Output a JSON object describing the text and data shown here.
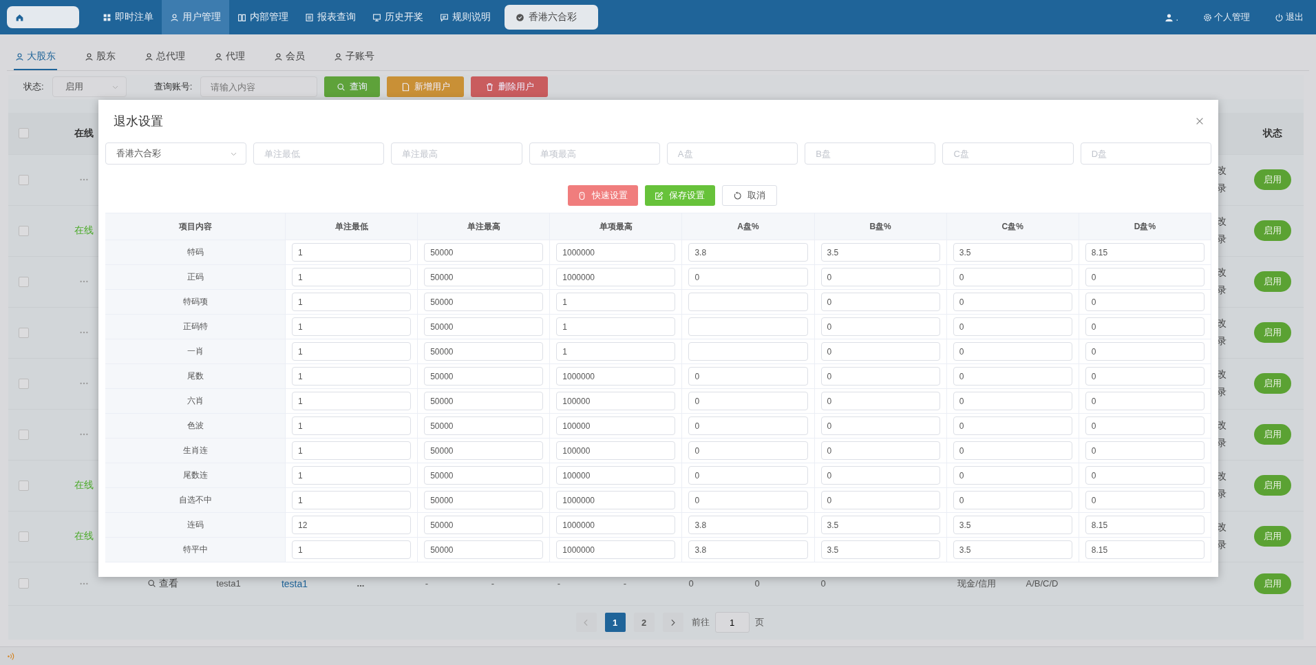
{
  "topbar": {
    "nav": [
      {
        "label": "即时注单",
        "selected": false
      },
      {
        "label": "用户管理",
        "selected": true
      },
      {
        "label": "内部管理",
        "selected": false
      },
      {
        "label": "报表查询",
        "selected": false
      },
      {
        "label": "历史开奖",
        "selected": false
      },
      {
        "label": "规则说明",
        "selected": false
      }
    ],
    "game_tab": {
      "label": "香港六合彩"
    },
    "user": {
      "name": "."
    },
    "links": [
      "个人管理",
      "退出"
    ]
  },
  "subtabs": [
    {
      "label": "大股东",
      "selected": true
    },
    {
      "label": "股东",
      "selected": false
    },
    {
      "label": "总代理",
      "selected": false
    },
    {
      "label": "代理",
      "selected": false
    },
    {
      "label": "会员",
      "selected": false
    },
    {
      "label": "子账号",
      "selected": false
    }
  ],
  "filters": {
    "status_label": "状态:",
    "status_value": "启用",
    "account_label": "查询账号:",
    "account_placeholder": "请输入内容",
    "buttons": [
      {
        "label": "查询",
        "kind": "search"
      },
      {
        "label": "新增用户",
        "kind": "add"
      },
      {
        "label": "删除用户",
        "kind": "delete"
      }
    ]
  },
  "table": {
    "header_checked": false,
    "header_online": "在线",
    "header_status": "状态",
    "rows": [
      {
        "checked": false,
        "online": false,
        "note": [
          "改",
          "录"
        ],
        "status": "启用"
      },
      {
        "checked": false,
        "online": true,
        "online_label": "在线",
        "note": [
          "改",
          "录"
        ],
        "status": "启用"
      },
      {
        "checked": false,
        "online": false,
        "note": [
          "改",
          "录"
        ],
        "status": "启用"
      },
      {
        "checked": false,
        "online": false,
        "note": [
          "改",
          "录"
        ],
        "status": "启用"
      },
      {
        "checked": false,
        "online": false,
        "note": [
          "改",
          "录"
        ],
        "status": "启用"
      },
      {
        "checked": false,
        "online": false,
        "note": [
          "改",
          "录"
        ],
        "status": "启用"
      },
      {
        "checked": false,
        "online": true,
        "online_label": "在线",
        "note": [
          "改",
          "录"
        ],
        "status": "启用"
      },
      {
        "checked": false,
        "online": true,
        "online_label": "在线",
        "note": [
          "改",
          "录"
        ],
        "status": "启用"
      }
    ],
    "last_row": {
      "checked": false,
      "online": false,
      "view": "查看",
      "account": "testa1",
      "name": "testa1",
      "column_6": "...",
      "cells": [
        "-",
        "-",
        "-",
        "-",
        "0",
        "0",
        "0"
      ],
      "mode": "现金/信用",
      "plates": "A/B/C/D",
      "status": "启用"
    }
  },
  "pagination": {
    "pages": [
      {
        "label": "1",
        "selected": true
      },
      {
        "label": "2",
        "selected": false
      }
    ],
    "goto_label": "前往",
    "goto_value": "1",
    "page_label": "页"
  },
  "modal": {
    "title": "退水设置",
    "game": "香港六合彩",
    "filters": [
      {
        "placeholder": "单注最低"
      },
      {
        "placeholder": "单注最高"
      },
      {
        "placeholder": "单项最高"
      },
      {
        "placeholder": "A盘"
      },
      {
        "placeholder": "B盘"
      },
      {
        "placeholder": "C盘"
      },
      {
        "placeholder": "D盘"
      }
    ],
    "buttons": [
      {
        "label": "快速设置",
        "kind": "quick"
      },
      {
        "label": "保存设置",
        "kind": "save"
      },
      {
        "label": "取消",
        "kind": "cancel"
      }
    ],
    "columns": [
      "项目内容",
      "单注最低",
      "单注最高",
      "单项最高",
      "A盘%",
      "B盘%",
      "C盘%",
      "D盘%"
    ],
    "rows": [
      {
        "item": "特码",
        "min": "1",
        "max": "50000",
        "item_max": "1000000",
        "a": "3.8",
        "b": "3.5",
        "c": "3.5",
        "d": "8.15"
      },
      {
        "item": "正码",
        "min": "1",
        "max": "50000",
        "item_max": "1000000",
        "a": "0",
        "b": "0",
        "c": "0",
        "d": "0"
      },
      {
        "item": "特码项",
        "min": "1",
        "max": "50000",
        "item_max": "1",
        "b": "0",
        "c": "0",
        "d": "0"
      },
      {
        "item": "正码特",
        "min": "1",
        "max": "50000",
        "item_max": "1",
        "b": "0",
        "c": "0",
        "d": "0"
      },
      {
        "item": "一肖",
        "min": "1",
        "max": "50000",
        "item_max": "1",
        "b": "0",
        "c": "0",
        "d": "0"
      },
      {
        "item": "尾数",
        "min": "1",
        "max": "50000",
        "item_max": "1000000",
        "a": "0",
        "b": "0",
        "c": "0",
        "d": "0"
      },
      {
        "item": "六肖",
        "min": "1",
        "max": "50000",
        "item_max": "100000",
        "a": "0",
        "b": "0",
        "c": "0",
        "d": "0"
      },
      {
        "item": "色波",
        "min": "1",
        "max": "50000",
        "item_max": "100000",
        "a": "0",
        "b": "0",
        "c": "0",
        "d": "0"
      },
      {
        "item": "生肖连",
        "min": "1",
        "max": "50000",
        "item_max": "100000",
        "a": "0",
        "b": "0",
        "c": "0",
        "d": "0"
      },
      {
        "item": "尾数连",
        "min": "1",
        "max": "50000",
        "item_max": "100000",
        "a": "0",
        "b": "0",
        "c": "0",
        "d": "0"
      },
      {
        "item": "自选不中",
        "min": "1",
        "max": "50000",
        "item_max": "1000000",
        "a": "0",
        "b": "0",
        "c": "0",
        "d": "0"
      },
      {
        "item": "连码",
        "min": "12",
        "max": "50000",
        "item_max": "1000000",
        "a": "3.8",
        "b": "3.5",
        "c": "3.5",
        "d": "8.15"
      },
      {
        "item": "特平中",
        "min": "1",
        "max": "50000",
        "item_max": "1000000",
        "a": "3.8",
        "b": "3.5",
        "c": "3.5",
        "d": "8.15"
      }
    ]
  }
}
